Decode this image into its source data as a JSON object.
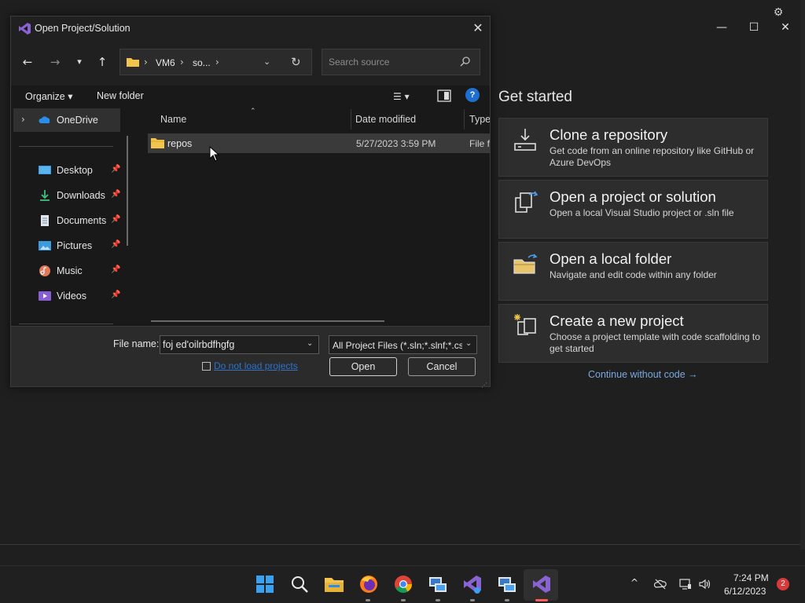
{
  "vs": {
    "get_started_title": "Get started",
    "cards": [
      {
        "title": "Clone a repository",
        "desc": "Get code from an online repository like GitHub or Azure DevOps",
        "icon": "clone-icon"
      },
      {
        "title": "Open a project or solution",
        "desc": "Open a local Visual Studio project or .sln file",
        "icon": "open-project-icon"
      },
      {
        "title": "Open a local folder",
        "desc": "Navigate and edit code within any folder",
        "icon": "open-folder-icon"
      },
      {
        "title": "Create a new project",
        "desc": "Choose a project template with code scaffolding to get started",
        "icon": "new-project-icon"
      }
    ],
    "continue_link": "Continue without code →"
  },
  "dialog": {
    "title": "Open Project/Solution",
    "breadcrumb": [
      "VM6",
      "so..."
    ],
    "search_placeholder": "Search source",
    "organize_label": "Organize ▾",
    "new_folder_label": "New folder",
    "help_label": "?",
    "nav_items": [
      {
        "label": "OneDrive",
        "icon": "onedrive-icon"
      },
      {
        "label": "Desktop",
        "icon": "desktop-icon"
      },
      {
        "label": "Downloads",
        "icon": "downloads-icon"
      },
      {
        "label": "Documents",
        "icon": "documents-icon"
      },
      {
        "label": "Pictures",
        "icon": "pictures-icon"
      },
      {
        "label": "Music",
        "icon": "music-icon"
      },
      {
        "label": "Videos",
        "icon": "videos-icon"
      }
    ],
    "columns": [
      "Name",
      "Date modified",
      "Type"
    ],
    "files": [
      {
        "name": "repos",
        "date": "5/27/2023 3:59 PM",
        "type": "File fo"
      }
    ],
    "file_name_label": "File name:",
    "file_name_value": "foj ed'oilrbdfhgfg",
    "file_type_value": "All Project Files (*.sln;*.slnf;*.csproj",
    "no_load_label": "Do not load projects",
    "open_label": "Open",
    "cancel_label": "Cancel"
  },
  "taskbar": {
    "apps": [
      "windows-start-icon",
      "search-icon",
      "file-explorer-icon",
      "firefox-icon",
      "chrome-icon",
      "remote-desktop-icon",
      "visual-studio-icon",
      "remote-desktop-icon",
      "visual-studio-icon"
    ],
    "time": "7:24 PM",
    "date": "6/12/2023",
    "notification_count": "2"
  },
  "colors": {
    "accent": "#1f6fd1",
    "vs_purple": "#8a63d2",
    "link": "#79a9e2",
    "folder": "#f3c44b"
  }
}
